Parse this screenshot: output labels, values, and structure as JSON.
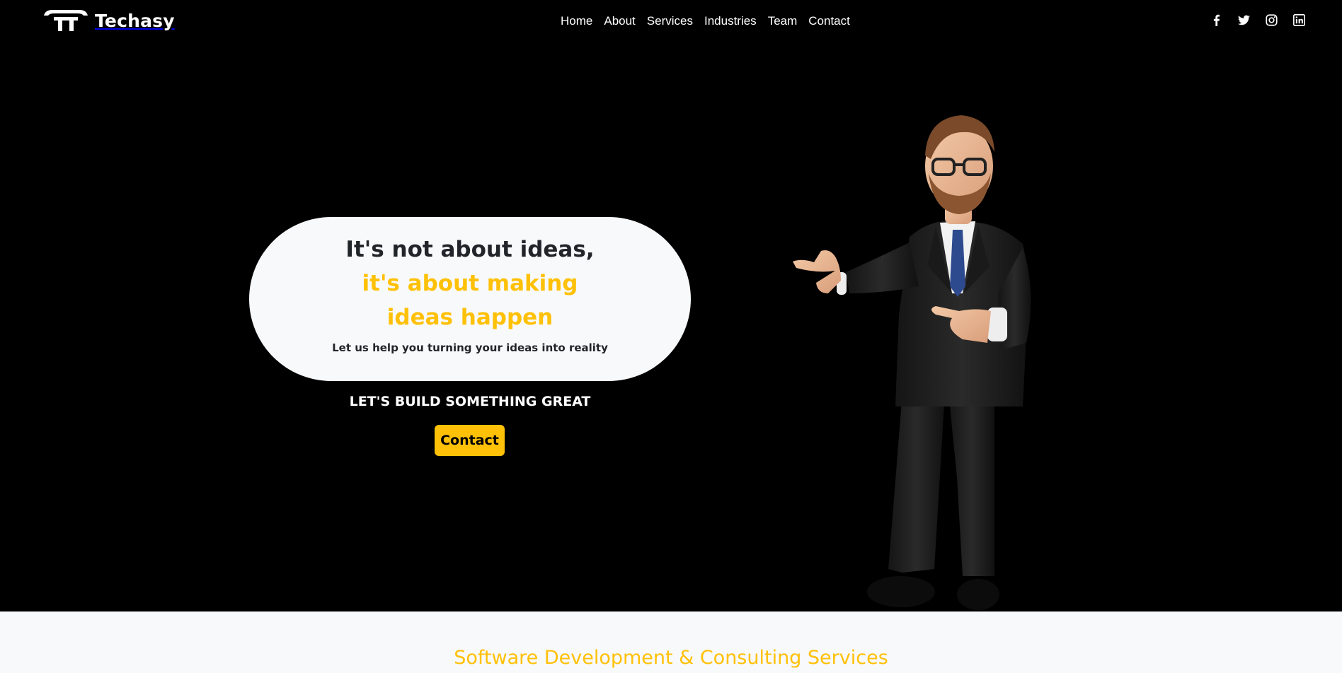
{
  "brand": {
    "name": "Techasy",
    "logo_icon": "techasy-logo-icon"
  },
  "nav": {
    "links": [
      "Home",
      "About",
      "Services",
      "Industries",
      "Team",
      "Contact"
    ]
  },
  "socials": [
    {
      "icon": "facebook-icon"
    },
    {
      "icon": "twitter-icon"
    },
    {
      "icon": "instagram-icon"
    },
    {
      "icon": "linkedin-icon"
    }
  ],
  "hero": {
    "headline_line1": "It's not about ideas,",
    "headline_line2": "it's about making",
    "headline_line3": "ideas happen",
    "subtext": "Let us help you turning your ideas into reality",
    "cta_text": "LET'S BUILD SOMETHING GREAT",
    "cta_button": "Contact",
    "illustration": "businessman-pointing-illustration"
  },
  "services": {
    "title": "Software Development & Consulting Services"
  },
  "colors": {
    "accent": "#ffc107",
    "background": "#000000",
    "light": "#f8f9fa",
    "dark_text": "#212529"
  }
}
